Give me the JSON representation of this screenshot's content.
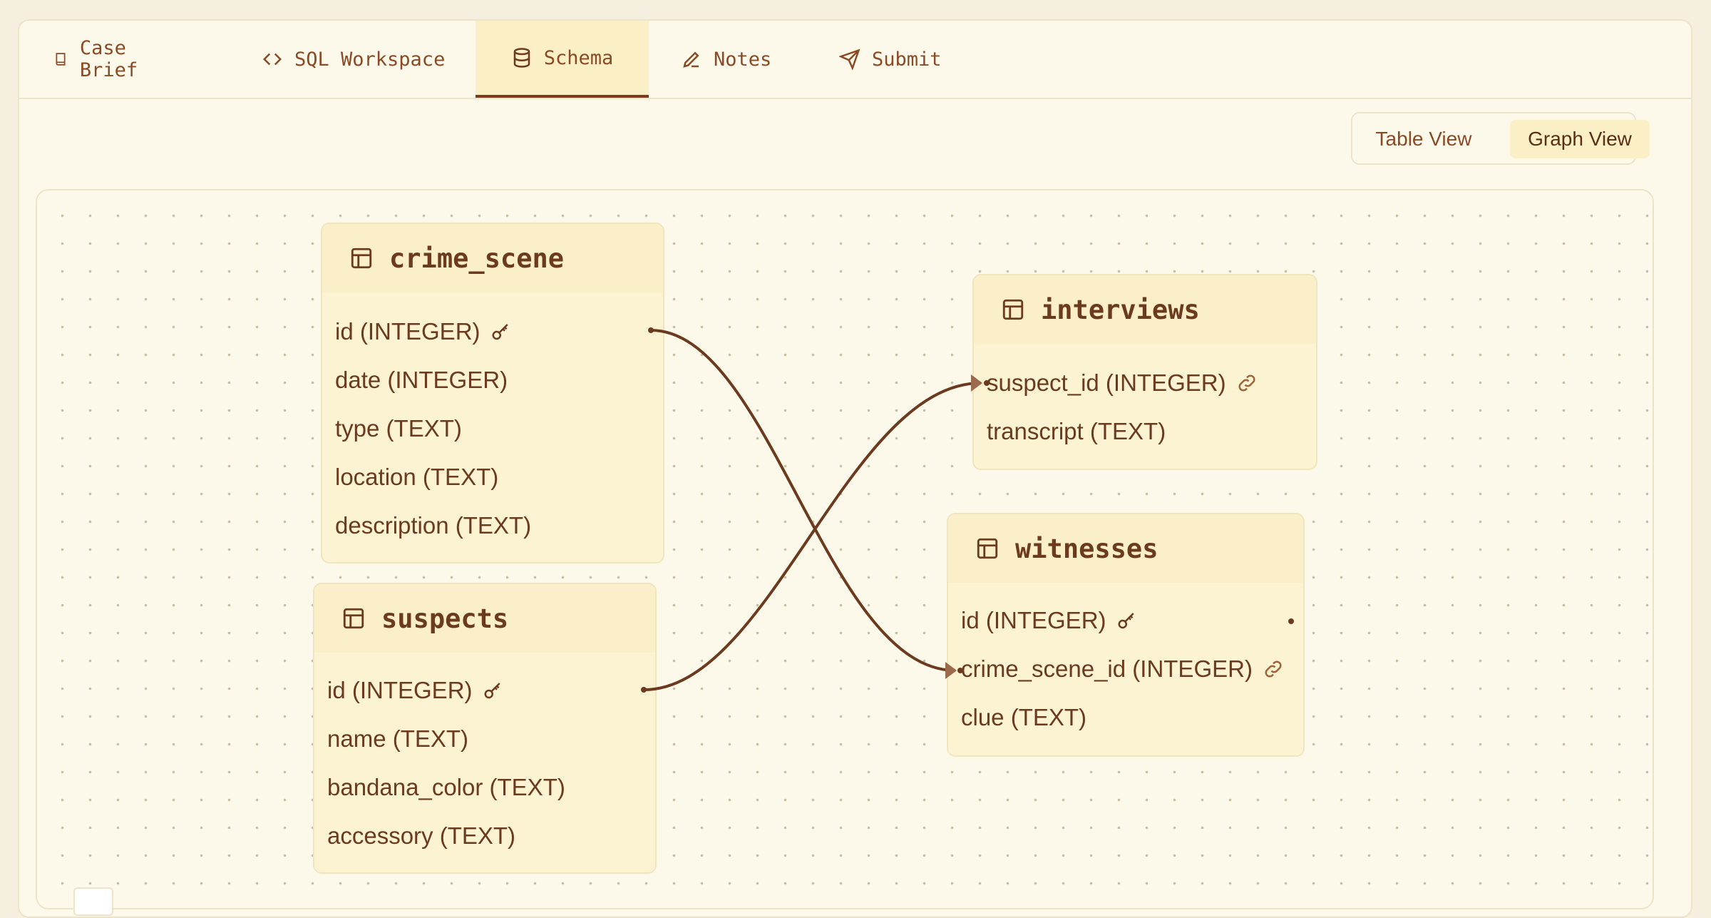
{
  "tabs": [
    {
      "label": "Case Brief",
      "icon": "book-icon"
    },
    {
      "label": "SQL Workspace",
      "icon": "code-icon"
    },
    {
      "label": "Schema",
      "icon": "database-icon",
      "active": true
    },
    {
      "label": "Notes",
      "icon": "pencil-icon"
    },
    {
      "label": "Submit",
      "icon": "send-icon"
    }
  ],
  "view_toggle": {
    "table_view": "Table View",
    "graph_view": "Graph View",
    "selected": "Graph View"
  },
  "tables": {
    "crime_scene": {
      "name": "crime_scene",
      "fields": [
        {
          "label": "id (INTEGER)",
          "key": "primary"
        },
        {
          "label": "date (INTEGER)"
        },
        {
          "label": "type (TEXT)"
        },
        {
          "label": "location (TEXT)"
        },
        {
          "label": "description (TEXT)"
        }
      ]
    },
    "suspects": {
      "name": "suspects",
      "fields": [
        {
          "label": "id (INTEGER)",
          "key": "primary"
        },
        {
          "label": "name (TEXT)"
        },
        {
          "label": "bandana_color (TEXT)"
        },
        {
          "label": "accessory (TEXT)"
        }
      ]
    },
    "interviews": {
      "name": "interviews",
      "fields": [
        {
          "label": "suspect_id (INTEGER)",
          "key": "foreign"
        },
        {
          "label": "transcript (TEXT)"
        }
      ]
    },
    "witnesses": {
      "name": "witnesses",
      "fields": [
        {
          "label": "id (INTEGER)",
          "key": "primary"
        },
        {
          "label": "crime_scene_id (INTEGER)",
          "key": "foreign"
        },
        {
          "label": "clue (TEXT)"
        }
      ]
    }
  },
  "relations": [
    {
      "from": "crime_scene.id",
      "to": "witnesses.crime_scene_id"
    },
    {
      "from": "suspects.id",
      "to": "interviews.suspect_id"
    }
  ],
  "colors": {
    "accent": "#6b3a1f",
    "tab_active_bg": "#fbefc5",
    "node_bg": "#fcf3d3"
  }
}
